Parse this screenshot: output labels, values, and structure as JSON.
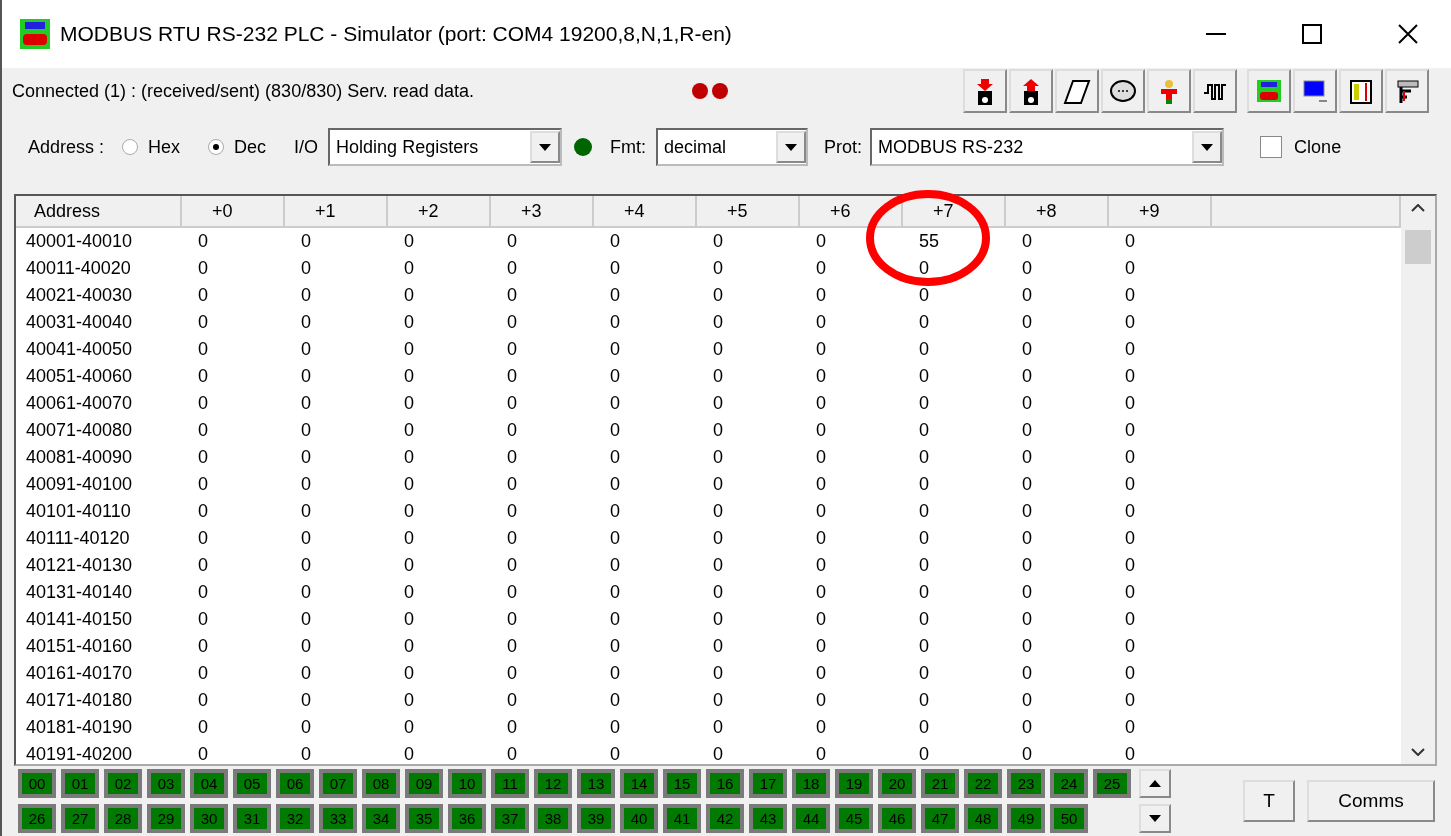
{
  "window": {
    "title": "MODBUS RTU RS-232 PLC - Simulator (port: COM4 19200,8,N,1,R-en)"
  },
  "status": {
    "text": "Connected (1) : (received/sent) (830/830) Serv. read data.",
    "lamps": [
      {
        "color": "#c00000"
      },
      {
        "color": "#c00000"
      }
    ]
  },
  "controls": {
    "address_label": "Address :",
    "radios": [
      {
        "label": "Hex",
        "selected": false
      },
      {
        "label": "Dec",
        "selected": true
      }
    ],
    "io_label": "I/O",
    "io_value": "Holding Registers",
    "io_lamp": {
      "color": "#006400"
    },
    "fmt_label": "Fmt:",
    "fmt_value": "decimal",
    "prot_label": "Prot:",
    "prot_value": "MODBUS RS-232",
    "clone": {
      "label": "Clone",
      "checked": false
    }
  },
  "table": {
    "columns": [
      "Address",
      "+0",
      "+1",
      "+2",
      "+3",
      "+4",
      "+5",
      "+6",
      "+7",
      "+8",
      "+9"
    ],
    "rows": [
      {
        "address": "40001-40010",
        "values": [
          "0",
          "0",
          "0",
          "0",
          "0",
          "0",
          "0",
          "55",
          "0",
          "0"
        ]
      },
      {
        "address": "40011-40020",
        "values": [
          "0",
          "0",
          "0",
          "0",
          "0",
          "0",
          "0",
          "0",
          "0",
          "0"
        ]
      },
      {
        "address": "40021-40030",
        "values": [
          "0",
          "0",
          "0",
          "0",
          "0",
          "0",
          "0",
          "0",
          "0",
          "0"
        ]
      },
      {
        "address": "40031-40040",
        "values": [
          "0",
          "0",
          "0",
          "0",
          "0",
          "0",
          "0",
          "0",
          "0",
          "0"
        ]
      },
      {
        "address": "40041-40050",
        "values": [
          "0",
          "0",
          "0",
          "0",
          "0",
          "0",
          "0",
          "0",
          "0",
          "0"
        ]
      },
      {
        "address": "40051-40060",
        "values": [
          "0",
          "0",
          "0",
          "0",
          "0",
          "0",
          "0",
          "0",
          "0",
          "0"
        ]
      },
      {
        "address": "40061-40070",
        "values": [
          "0",
          "0",
          "0",
          "0",
          "0",
          "0",
          "0",
          "0",
          "0",
          "0"
        ]
      },
      {
        "address": "40071-40080",
        "values": [
          "0",
          "0",
          "0",
          "0",
          "0",
          "0",
          "0",
          "0",
          "0",
          "0"
        ]
      },
      {
        "address": "40081-40090",
        "values": [
          "0",
          "0",
          "0",
          "0",
          "0",
          "0",
          "0",
          "0",
          "0",
          "0"
        ]
      },
      {
        "address": "40091-40100",
        "values": [
          "0",
          "0",
          "0",
          "0",
          "0",
          "0",
          "0",
          "0",
          "0",
          "0"
        ]
      },
      {
        "address": "40101-40110",
        "values": [
          "0",
          "0",
          "0",
          "0",
          "0",
          "0",
          "0",
          "0",
          "0",
          "0"
        ]
      },
      {
        "address": "40111-40120",
        "values": [
          "0",
          "0",
          "0",
          "0",
          "0",
          "0",
          "0",
          "0",
          "0",
          "0"
        ]
      },
      {
        "address": "40121-40130",
        "values": [
          "0",
          "0",
          "0",
          "0",
          "0",
          "0",
          "0",
          "0",
          "0",
          "0"
        ]
      },
      {
        "address": "40131-40140",
        "values": [
          "0",
          "0",
          "0",
          "0",
          "0",
          "0",
          "0",
          "0",
          "0",
          "0"
        ]
      },
      {
        "address": "40141-40150",
        "values": [
          "0",
          "0",
          "0",
          "0",
          "0",
          "0",
          "0",
          "0",
          "0",
          "0"
        ]
      },
      {
        "address": "40151-40160",
        "values": [
          "0",
          "0",
          "0",
          "0",
          "0",
          "0",
          "0",
          "0",
          "0",
          "0"
        ]
      },
      {
        "address": "40161-40170",
        "values": [
          "0",
          "0",
          "0",
          "0",
          "0",
          "0",
          "0",
          "0",
          "0",
          "0"
        ]
      },
      {
        "address": "40171-40180",
        "values": [
          "0",
          "0",
          "0",
          "0",
          "0",
          "0",
          "0",
          "0",
          "0",
          "0"
        ]
      },
      {
        "address": "40181-40190",
        "values": [
          "0",
          "0",
          "0",
          "0",
          "0",
          "0",
          "0",
          "0",
          "0",
          "0"
        ]
      },
      {
        "address": "40191-40200",
        "values": [
          "0",
          "0",
          "0",
          "0",
          "0",
          "0",
          "0",
          "0",
          "0",
          "0"
        ]
      }
    ]
  },
  "stations": [
    {
      "label": "00",
      "on": true
    },
    {
      "label": "01",
      "on": true
    },
    {
      "label": "02",
      "on": true
    },
    {
      "label": "03",
      "on": true
    },
    {
      "label": "04",
      "on": true
    },
    {
      "label": "05",
      "on": true
    },
    {
      "label": "06",
      "on": true
    },
    {
      "label": "07",
      "on": true
    },
    {
      "label": "08",
      "on": true
    },
    {
      "label": "09",
      "on": true
    },
    {
      "label": "10",
      "on": true
    },
    {
      "label": "11",
      "on": true
    },
    {
      "label": "12",
      "on": true
    },
    {
      "label": "13",
      "on": true
    },
    {
      "label": "14",
      "on": true
    },
    {
      "label": "15",
      "on": true
    },
    {
      "label": "16",
      "on": true
    },
    {
      "label": "17",
      "on": true
    },
    {
      "label": "18",
      "on": true
    },
    {
      "label": "19",
      "on": true
    },
    {
      "label": "20",
      "on": true
    },
    {
      "label": "21",
      "on": true
    },
    {
      "label": "22",
      "on": true
    },
    {
      "label": "23",
      "on": true
    },
    {
      "label": "24",
      "on": true
    },
    {
      "label": "25",
      "on": true
    },
    {
      "label": "26",
      "on": true
    },
    {
      "label": "27",
      "on": true
    },
    {
      "label": "28",
      "on": true
    },
    {
      "label": "29",
      "on": true
    },
    {
      "label": "30",
      "on": true
    },
    {
      "label": "31",
      "on": true
    },
    {
      "label": "32",
      "on": true
    },
    {
      "label": "33",
      "on": true
    },
    {
      "label": "34",
      "on": true
    },
    {
      "label": "35",
      "on": true
    },
    {
      "label": "36",
      "on": true
    },
    {
      "label": "37",
      "on": true
    },
    {
      "label": "38",
      "on": true
    },
    {
      "label": "39",
      "on": true
    },
    {
      "label": "40",
      "on": true
    },
    {
      "label": "41",
      "on": true
    },
    {
      "label": "42",
      "on": true
    },
    {
      "label": "43",
      "on": true
    },
    {
      "label": "44",
      "on": true
    },
    {
      "label": "45",
      "on": true
    },
    {
      "label": "46",
      "on": true
    },
    {
      "label": "47",
      "on": true
    },
    {
      "label": "48",
      "on": true
    },
    {
      "label": "49",
      "on": true
    },
    {
      "label": "50",
      "on": true
    }
  ],
  "buttons": [
    "T",
    "Comms"
  ]
}
